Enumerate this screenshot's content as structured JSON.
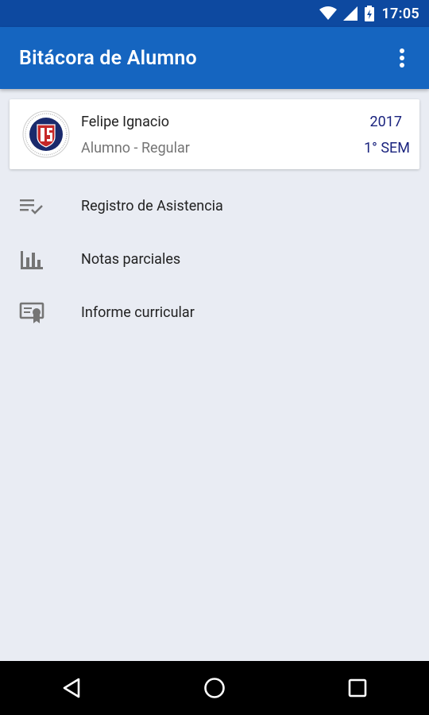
{
  "status_bar": {
    "time": "17:05"
  },
  "app_bar": {
    "title": "Bitácora de Alumno",
    "menu_icon": "more-vert-icon"
  },
  "student_card": {
    "name": "Felipe Ignacio",
    "role": "Alumno - Regular",
    "year": "2017",
    "semester": "1° SEM",
    "logo_icon": "university-logo-icon"
  },
  "menu": {
    "items": [
      {
        "label": "Registro de Asistencia",
        "icon": "checklist-icon"
      },
      {
        "label": "Notas parciales",
        "icon": "bar-chart-icon"
      },
      {
        "label": "Informe curricular",
        "icon": "certificate-icon"
      }
    ]
  },
  "colors": {
    "status_bar": "#0d49a0",
    "app_bar": "#1565c0",
    "background": "#e9ecf3",
    "accent_text": "#1a237e"
  }
}
